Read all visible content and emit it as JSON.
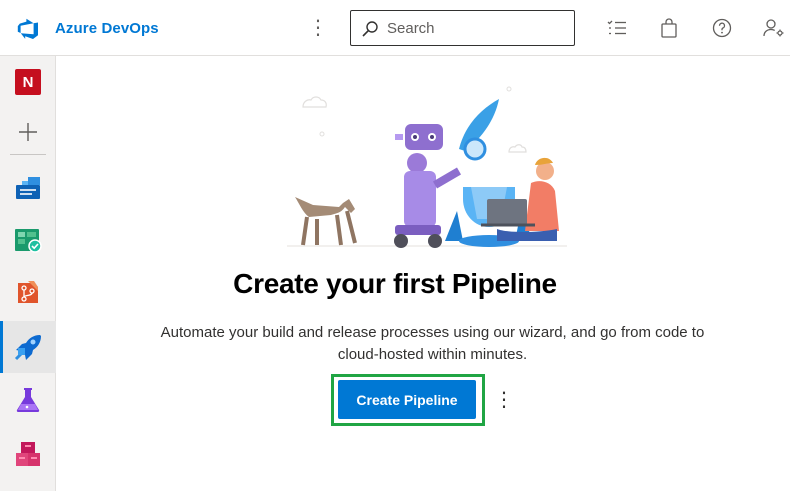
{
  "header": {
    "brand": "Azure DevOps",
    "search_placeholder": "Search",
    "more_glyph": "⋮",
    "icons": [
      "azure-devops-logo-icon",
      "more-vertical-icon",
      "search-icon",
      "task-list-icon",
      "shopping-bag-icon",
      "help-icon",
      "user-settings-icon"
    ]
  },
  "rail": {
    "org_initial": "N",
    "items": [
      {
        "name": "organization",
        "icon": "org-badge-icon"
      },
      {
        "name": "new-project",
        "icon": "plus-icon"
      },
      {
        "name": "overview",
        "icon": "overview-icon"
      },
      {
        "name": "boards",
        "icon": "boards-icon"
      },
      {
        "name": "repos",
        "icon": "repos-icon"
      },
      {
        "name": "pipelines",
        "icon": "pipelines-icon",
        "active": true
      },
      {
        "name": "test-plans",
        "icon": "test-plans-icon"
      },
      {
        "name": "artifacts",
        "icon": "artifacts-icon"
      }
    ]
  },
  "main": {
    "title": "Create your first Pipeline",
    "description": "Automate your build and release processes using our wizard, and go from code to cloud-hosted within minutes.",
    "cta_label": "Create Pipeline",
    "cta_more_glyph": "⋮"
  },
  "colors": {
    "accent": "#0078d4",
    "highlight": "#20a544",
    "org_badge": "#c50f1f"
  }
}
